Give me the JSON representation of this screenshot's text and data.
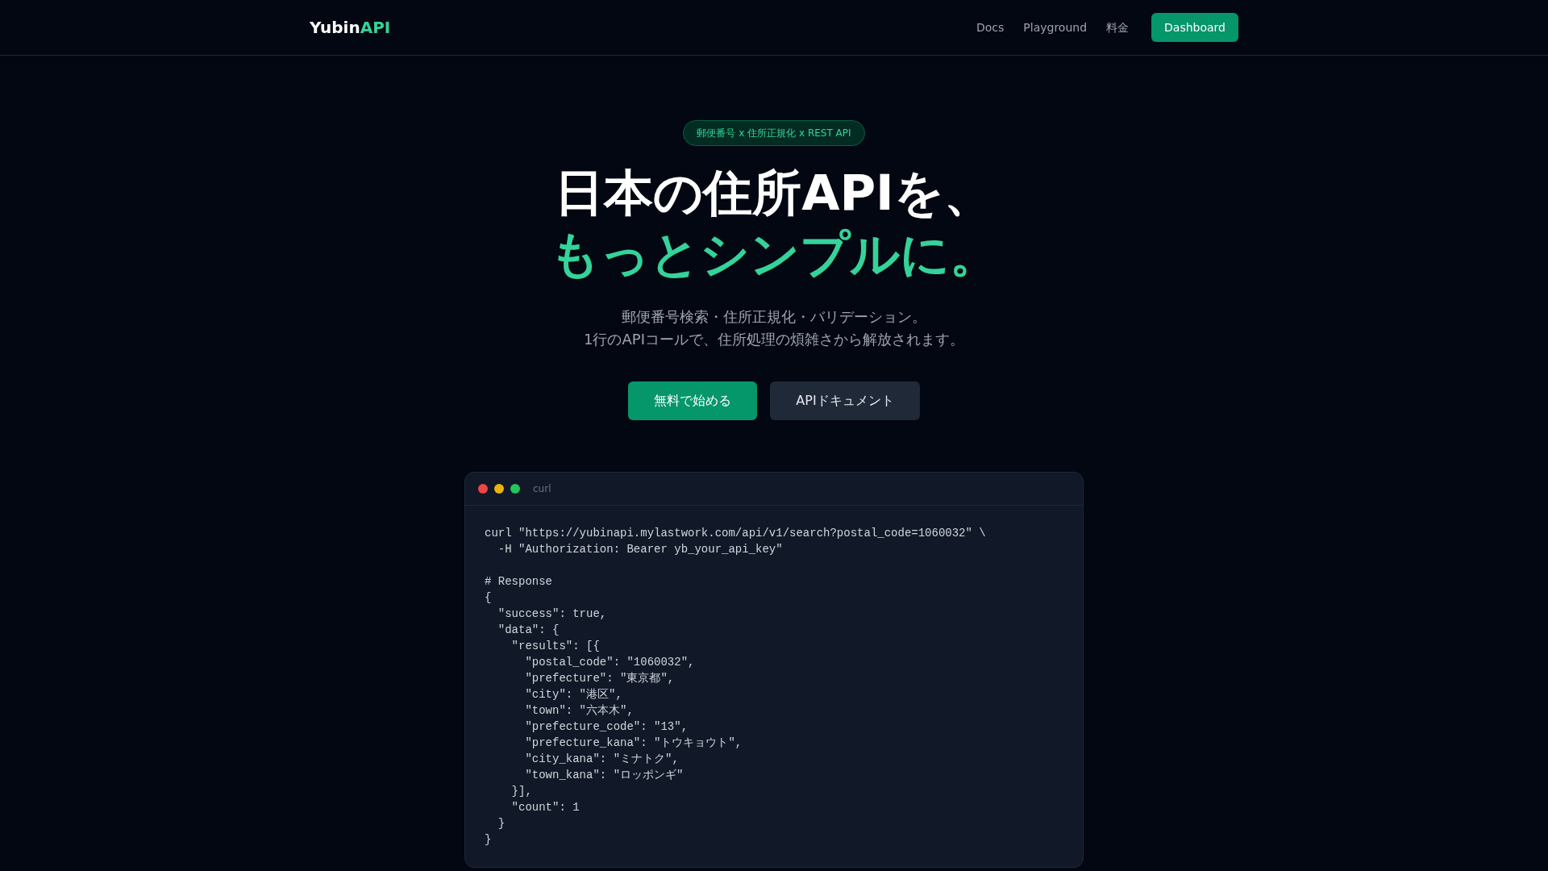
{
  "header": {
    "logo": [
      {
        "text": "Yubin",
        "accent": false
      },
      {
        "text": "API",
        "accent": true
      }
    ],
    "nav": [
      {
        "label": "Docs",
        "kind": "link"
      },
      {
        "label": "Playground",
        "kind": "link"
      },
      {
        "label": "料金",
        "kind": "link"
      },
      {
        "label": "Dashboard",
        "kind": "button"
      }
    ]
  },
  "hero": {
    "badge": "郵便番号 x 住所正規化 x REST API",
    "title_lines": [
      {
        "text": "日本の住所APIを、",
        "accent": false
      },
      {
        "text": "もっとシンプルに。",
        "accent": true
      }
    ],
    "subtitle_lines": [
      "郵便番号検索・住所正規化・バリデーション。",
      "1行のAPIコールで、住所処理の煩雑さから解放されます。"
    ],
    "buttons": [
      {
        "label": "無料で始める",
        "kind": "primary"
      },
      {
        "label": "APIドキュメント",
        "kind": "secondary"
      }
    ]
  },
  "code_window": {
    "dots": [
      {
        "color": "#ef4444"
      },
      {
        "color": "#eab308"
      },
      {
        "color": "#22c55e"
      }
    ],
    "title": "curl",
    "code": "curl \"https://yubinapi.mylastwork.com/api/v1/search?postal_code=1060032\" \\\n  -H \"Authorization: Bearer yb_your_api_key\"\n\n# Response\n{\n  \"success\": true,\n  \"data\": {\n    \"results\": [{\n      \"postal_code\": \"1060032\",\n      \"prefecture\": \"東京都\",\n      \"city\": \"港区\",\n      \"town\": \"六本木\",\n      \"prefecture_code\": \"13\",\n      \"prefecture_kana\": \"トウキョウト\",\n      \"city_kana\": \"ミナトク\",\n      \"town_kana\": \"ロッポンギ\"\n    }],\n    \"count\": 1\n  }\n}"
  }
}
